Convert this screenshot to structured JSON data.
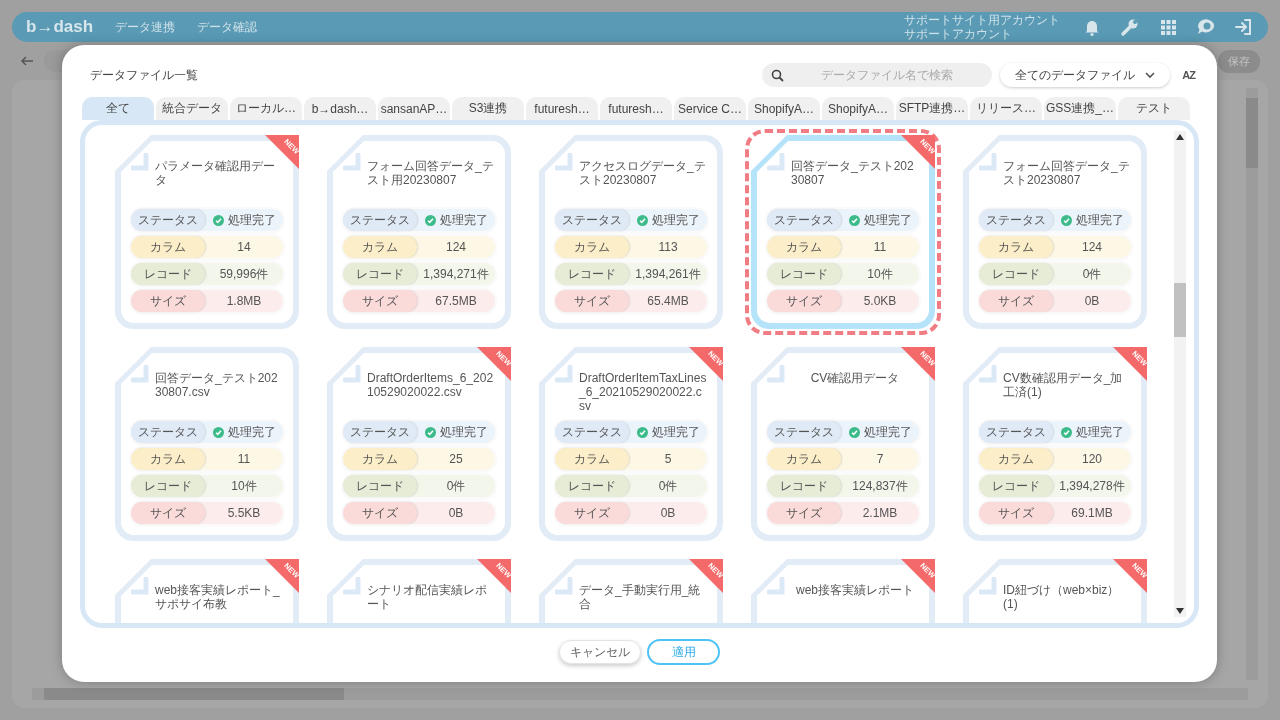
{
  "app_header": {
    "logo": "b→dash",
    "nav": [
      "データ連携",
      "データ確認"
    ],
    "account": [
      "サポートサイト用アカウント",
      "サポートアカウント"
    ]
  },
  "toolbar": {
    "save": "保存"
  },
  "dialog": {
    "title": "データファイル一覧",
    "search": {
      "placeholder": "データファイル名で検索"
    },
    "filter": {
      "value": "全てのデータファイル"
    },
    "sort": "AZ",
    "tabs": [
      {
        "label": "全て",
        "selected": true
      },
      {
        "label": "統合データ",
        "selected": false
      },
      {
        "label": "ローカル…",
        "selected": false
      },
      {
        "label": "b→dash…",
        "selected": false
      },
      {
        "label": "sansanAP…",
        "selected": false
      },
      {
        "label": "S3連携",
        "selected": false
      },
      {
        "label": "futuresh…",
        "selected": false
      },
      {
        "label": "futuresh…",
        "selected": false
      },
      {
        "label": "Service C…",
        "selected": false
      },
      {
        "label": "ShopifyA…",
        "selected": false
      },
      {
        "label": "ShopifyA…",
        "selected": false
      },
      {
        "label": "SFTP連携…",
        "selected": false
      },
      {
        "label": "リリース…",
        "selected": false
      },
      {
        "label": "GSS連携_…",
        "selected": false
      },
      {
        "label": "テスト",
        "selected": false
      }
    ],
    "cards": [
      {
        "title": "パラメータ確認用データ",
        "badge": "NEW",
        "selected": false,
        "stats": [
          {
            "kind": "status",
            "label": "ステータス",
            "value": "処理完了"
          },
          {
            "kind": "columns",
            "label": "カラム",
            "value": "14"
          },
          {
            "kind": "records",
            "label": "レコード",
            "value": "59,996件"
          },
          {
            "kind": "size",
            "label": "サイズ",
            "value": "1.8MB"
          }
        ]
      },
      {
        "title": "フォーム回答データ_テスト用20230807",
        "selected": false,
        "stats": [
          {
            "kind": "status",
            "label": "ステータス",
            "value": "処理完了"
          },
          {
            "kind": "columns",
            "label": "カラム",
            "value": "124"
          },
          {
            "kind": "records",
            "label": "レコード",
            "value": "1,394,271件"
          },
          {
            "kind": "size",
            "label": "サイズ",
            "value": "67.5MB"
          }
        ]
      },
      {
        "title": "アクセスログデータ_テスト20230807",
        "selected": false,
        "stats": [
          {
            "kind": "status",
            "label": "ステータス",
            "value": "処理完了"
          },
          {
            "kind": "columns",
            "label": "カラム",
            "value": "113"
          },
          {
            "kind": "records",
            "label": "レコード",
            "value": "1,394,261件"
          },
          {
            "kind": "size",
            "label": "サイズ",
            "value": "65.4MB"
          }
        ]
      },
      {
        "title": "回答データ_テスト20230807",
        "badge": "NEW",
        "selected": true,
        "stats": [
          {
            "kind": "status",
            "label": "ステータス",
            "value": "処理完了"
          },
          {
            "kind": "columns",
            "label": "カラム",
            "value": "11"
          },
          {
            "kind": "records",
            "label": "レコード",
            "value": "10件"
          },
          {
            "kind": "size",
            "label": "サイズ",
            "value": "5.0KB"
          }
        ]
      },
      {
        "title": "フォーム回答データ_テスト20230807",
        "selected": false,
        "stats": [
          {
            "kind": "status",
            "label": "ステータス",
            "value": "処理完了"
          },
          {
            "kind": "columns",
            "label": "カラム",
            "value": "124"
          },
          {
            "kind": "records",
            "label": "レコード",
            "value": "0件"
          },
          {
            "kind": "size",
            "label": "サイズ",
            "value": "0B"
          }
        ]
      },
      {
        "title": "回答データ_テスト20230807.csv",
        "selected": false,
        "stats": [
          {
            "kind": "status",
            "label": "ステータス",
            "value": "処理完了"
          },
          {
            "kind": "columns",
            "label": "カラム",
            "value": "11"
          },
          {
            "kind": "records",
            "label": "レコード",
            "value": "10件"
          },
          {
            "kind": "size",
            "label": "サイズ",
            "value": "5.5KB"
          }
        ]
      },
      {
        "title": "DraftOrderItems_6_20210529020022.csv",
        "badge": "NEW",
        "selected": false,
        "stats": [
          {
            "kind": "status",
            "label": "ステータス",
            "value": "処理完了"
          },
          {
            "kind": "columns",
            "label": "カラム",
            "value": "25"
          },
          {
            "kind": "records",
            "label": "レコード",
            "value": "0件"
          },
          {
            "kind": "size",
            "label": "サイズ",
            "value": "0B"
          }
        ]
      },
      {
        "title": "DraftOrderItemTaxLines_6_20210529020022.csv",
        "badge": "NEW",
        "selected": false,
        "stats": [
          {
            "kind": "status",
            "label": "ステータス",
            "value": "処理完了"
          },
          {
            "kind": "columns",
            "label": "カラム",
            "value": "5"
          },
          {
            "kind": "records",
            "label": "レコード",
            "value": "0件"
          },
          {
            "kind": "size",
            "label": "サイズ",
            "value": "0B"
          }
        ]
      },
      {
        "title": "CV確認用データ",
        "badge": "NEW",
        "selected": false,
        "stats": [
          {
            "kind": "status",
            "label": "ステータス",
            "value": "処理完了"
          },
          {
            "kind": "columns",
            "label": "カラム",
            "value": "7"
          },
          {
            "kind": "records",
            "label": "レコード",
            "value": "124,837件"
          },
          {
            "kind": "size",
            "label": "サイズ",
            "value": "2.1MB"
          }
        ]
      },
      {
        "title": "CV数確認用データ_加工済(1)",
        "badge": "NEW",
        "selected": false,
        "stats": [
          {
            "kind": "status",
            "label": "ステータス",
            "value": "処理完了"
          },
          {
            "kind": "columns",
            "label": "カラム",
            "value": "120"
          },
          {
            "kind": "records",
            "label": "レコード",
            "value": "1,394,278件"
          },
          {
            "kind": "size",
            "label": "サイズ",
            "value": "69.1MB"
          }
        ]
      },
      {
        "title": "web接客実績レポート_サポサイ布教",
        "badge": "NEW",
        "selected": false
      },
      {
        "title": "シナリオ配信実績レポート",
        "badge": "NEW",
        "selected": false
      },
      {
        "title": "データ_手動実行用_統合",
        "badge": "NEW",
        "selected": false
      },
      {
        "title": "web接客実績レポート",
        "badge": "NEW",
        "selected": false
      },
      {
        "title": "ID紐づけ（web×biz）(1)",
        "badge": "NEW",
        "selected": false
      }
    ],
    "buttons": {
      "cancel": "キャンセル",
      "apply": "適用"
    }
  }
}
